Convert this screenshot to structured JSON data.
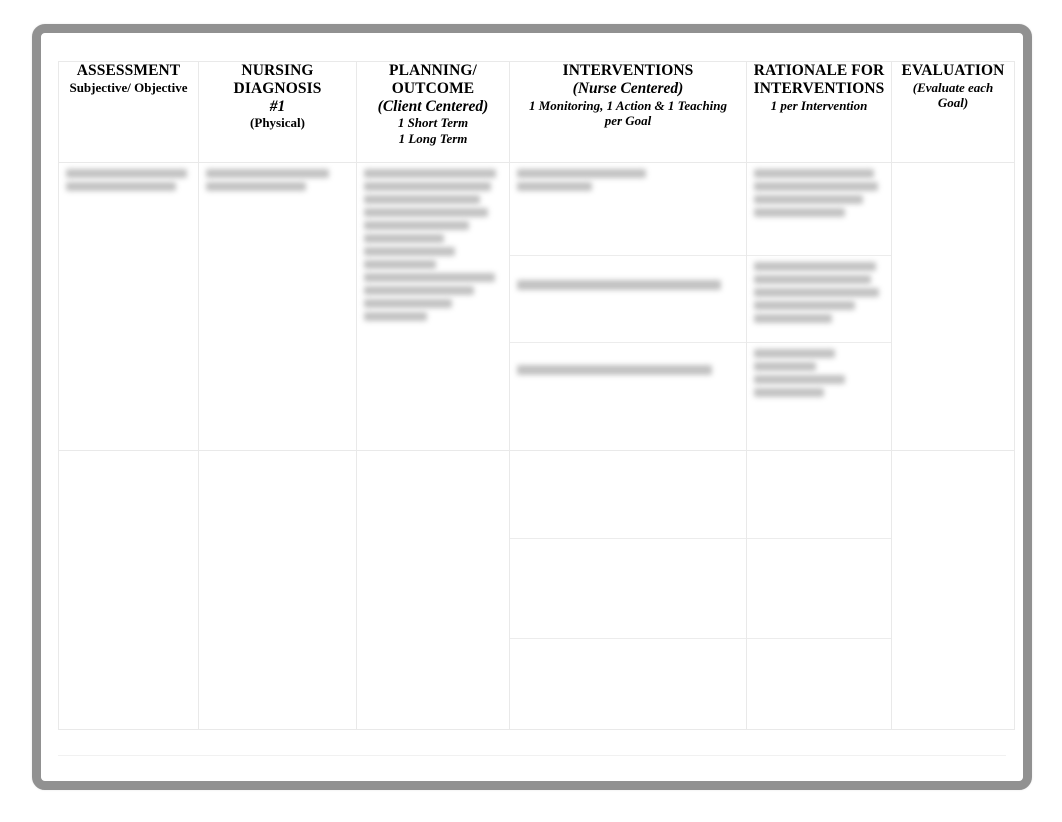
{
  "document": {
    "type": "nursing-care-plan-table",
    "page_background": "#ffffff",
    "frame_color": "#919191",
    "grid_line_color": "#e9e9e9"
  },
  "table": {
    "columns": [
      {
        "key": "assessment",
        "title": "ASSESSMENT",
        "sub1": "Subjective/ Objective",
        "sub2": "",
        "sub3": "",
        "sub4": ""
      },
      {
        "key": "nursing_diagnosis",
        "title_line1": "NURSING",
        "title_line2": "DIAGNOSIS",
        "title_line3": "#1",
        "sub1": "(Physical)"
      },
      {
        "key": "planning_outcome",
        "title_line1": "PLANNING/",
        "title_line2": "OUTCOME",
        "sub1": "(Client Centered)",
        "sub2": "1 Short Term",
        "sub3": "1 Long Term"
      },
      {
        "key": "interventions",
        "title": "INTERVENTIONS",
        "sub1": "(Nurse Centered)",
        "sub2": "1 Monitoring, 1 Action & 1 Teaching",
        "sub3": "per Goal"
      },
      {
        "key": "rationale",
        "title_line1": "RATIONALE FOR",
        "title_line2": "INTERVENTIONS",
        "sub1": "1 per Intervention"
      },
      {
        "key": "evaluation",
        "title": "EVALUATION",
        "sub1": "(Evaluate each",
        "sub2": "Goal)"
      }
    ],
    "rows": [
      {
        "row_index": 1,
        "assessment": {
          "redacted": true,
          "line_count": 2
        },
        "nursing_diagnosis": {
          "redacted": true,
          "line_count": 2
        },
        "planning_outcome": {
          "redacted": true,
          "line_count": 12
        },
        "interventions_subrows": [
          {
            "redacted": true,
            "line_count": 2
          },
          {
            "redacted": true,
            "line_count": 1
          },
          {
            "redacted": true,
            "line_count": 1
          }
        ],
        "rationale_subrows": [
          {
            "redacted": true,
            "line_count": 4
          },
          {
            "redacted": true,
            "line_count": 5
          },
          {
            "redacted": true,
            "line_count": 4
          }
        ],
        "evaluation": {
          "redacted": true,
          "line_count": 0
        }
      },
      {
        "row_index": 2,
        "assessment": {
          "redacted": true,
          "line_count": 0
        },
        "nursing_diagnosis": {
          "redacted": true,
          "line_count": 0
        },
        "planning_outcome": {
          "redacted": true,
          "line_count": 0
        },
        "interventions_subrows": [
          {
            "redacted": true,
            "line_count": 0
          },
          {
            "redacted": true,
            "line_count": 0
          },
          {
            "redacted": true,
            "line_count": 0
          }
        ],
        "rationale_subrows": [
          {
            "redacted": true,
            "line_count": 0
          },
          {
            "redacted": true,
            "line_count": 0
          },
          {
            "redacted": true,
            "line_count": 0
          }
        ],
        "evaluation": {
          "redacted": true,
          "line_count": 0
        }
      }
    ]
  }
}
